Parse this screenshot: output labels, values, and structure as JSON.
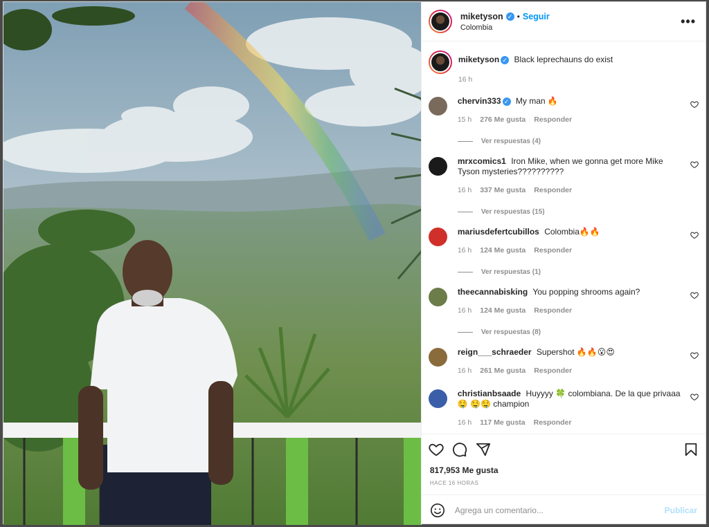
{
  "header": {
    "username": "miketyson",
    "verified_mark": "✓",
    "separator": "•",
    "follow_label": "Seguir",
    "location": "Colombia",
    "more_label": "•••"
  },
  "caption": {
    "username": "miketyson",
    "verified_mark": "✓",
    "text": "Black leprechauns do exist",
    "time": "16 h"
  },
  "comments": [
    {
      "username": "chervin333",
      "verified": true,
      "verified_mark": "✓",
      "text": "My man 🔥",
      "time": "15 h",
      "likes": "276 Me gusta",
      "reply_label": "Responder",
      "view_replies": "Ver respuestas (4)",
      "avatar_color": "#7a6a5c"
    },
    {
      "username": "mrxcomics1",
      "verified": false,
      "text": "Iron Mike, when we gonna get more Mike Tyson mysteries??????????",
      "time": "16 h",
      "likes": "337 Me gusta",
      "reply_label": "Responder",
      "view_replies": "Ver respuestas (15)",
      "avatar_color": "#1a1a1a"
    },
    {
      "username": "mariusdefertcubillos",
      "verified": false,
      "text": "Colombia🔥🔥",
      "time": "16 h",
      "likes": "124 Me gusta",
      "reply_label": "Responder",
      "view_replies": "Ver respuestas (1)",
      "avatar_color": "#d0302a"
    },
    {
      "username": "theecannabisking",
      "verified": false,
      "text": "You popping shrooms again?",
      "time": "16 h",
      "likes": "124 Me gusta",
      "reply_label": "Responder",
      "view_replies": "Ver respuestas (8)",
      "avatar_color": "#6c7d4a"
    },
    {
      "username": "reign___schraeder",
      "verified": false,
      "text": "Supershot 🔥🔥😮😍",
      "time": "16 h",
      "likes": "261 Me gusta",
      "reply_label": "Responder",
      "view_replies": "",
      "avatar_color": "#8a6b3c"
    },
    {
      "username": "christianbsaade",
      "verified": false,
      "text": "Huyyyy 🍀 colombiana. De la que privaaa 🤤 🤤🤤 champion",
      "time": "16 h",
      "likes": "117 Me gusta",
      "reply_label": "Responder",
      "view_replies": "",
      "avatar_color": "#3b5ea8"
    }
  ],
  "actions": {
    "like_icon": "heart-icon",
    "comment_icon": "comment-icon",
    "share_icon": "share-icon",
    "save_icon": "bookmark-icon"
  },
  "likes_count": "817,953 Me gusta",
  "posted_ago": "HACE 16 HORAS",
  "comment_input": {
    "placeholder": "Agrega un comentario...",
    "emoji_icon": "smiley-icon",
    "publish_label": "Publicar"
  },
  "colors": {
    "accent_blue": "#0095f6",
    "publish_disabled": "#b2dffc",
    "muted": "#8e8e8e"
  }
}
